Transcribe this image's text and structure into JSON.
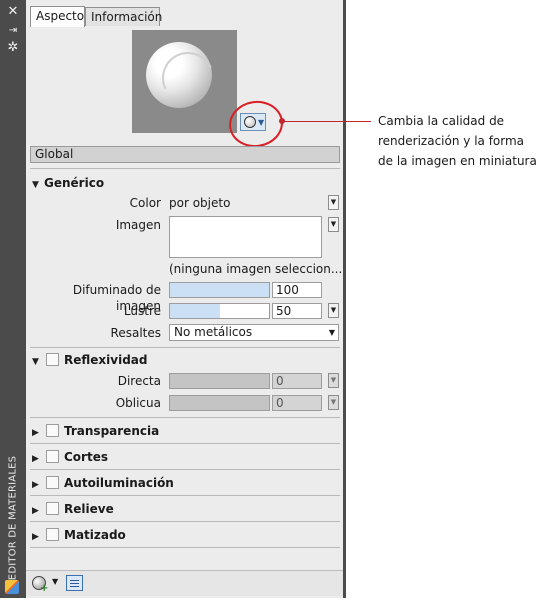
{
  "palette": {
    "vertical_title": "EDITOR DE MATERIALES",
    "strip_icons": [
      "close-icon",
      "pin-icon",
      "settings-icon"
    ]
  },
  "tabs": [
    {
      "label": "Aspecto",
      "active": true
    },
    {
      "label": "Información",
      "active": false
    }
  ],
  "material_name": "Global",
  "sections": {
    "generic": {
      "title": "Genérico",
      "color_label": "Color",
      "color_value": "por objeto",
      "image_label": "Imagen",
      "image_note": "(ninguna imagen seleccion...",
      "fade_label": "Difuminado de imagen",
      "fade_value": "100",
      "fade_level": 1.0,
      "gloss_label": "Lustre",
      "gloss_value": "50",
      "gloss_level": 0.5,
      "highlights_label": "Resaltes",
      "highlights_value": "No metálicos"
    },
    "reflectivity": {
      "title": "Reflexividad",
      "direct_label": "Directa",
      "direct_value": "0",
      "oblique_label": "Oblicua",
      "oblique_value": "0"
    },
    "collapsed": [
      "Transparencia",
      "Cortes",
      "Autoiluminación",
      "Relieve",
      "Matizado"
    ]
  },
  "callout": {
    "lines": [
      "Cambia la calidad de",
      "renderización y la forma",
      "de la imagen en miniatura"
    ],
    "color": "#c1272d"
  }
}
